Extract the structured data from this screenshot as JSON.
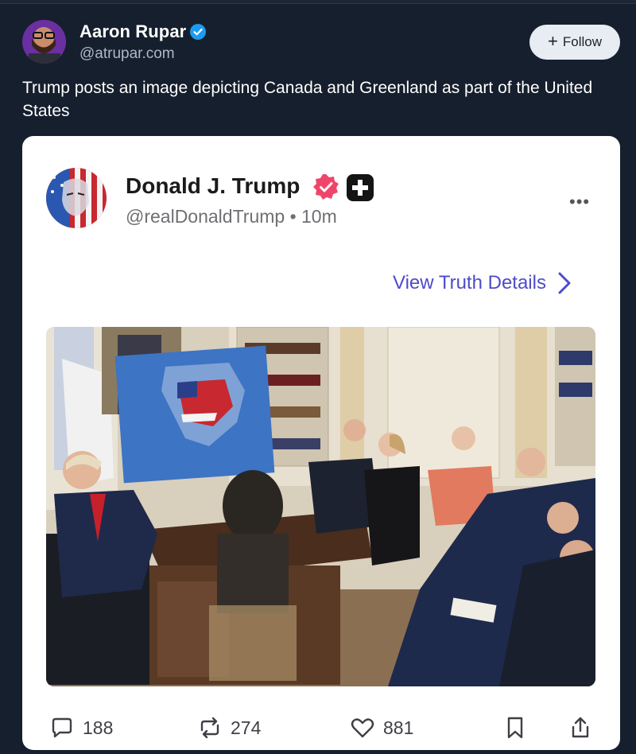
{
  "post": {
    "author_name": "Aaron Rupar",
    "author_handle": "@atrupar.com",
    "follow_label": "Follow",
    "text": "Trump posts an image depicting Canada and Greenland as part of the United States"
  },
  "embed": {
    "name": "Donald J. Trump",
    "handle": "@realDonaldTrump",
    "time": "• 10m",
    "more": "•••",
    "view_details": "View Truth Details",
    "stats": {
      "replies": "188",
      "reposts": "274",
      "likes": "881"
    }
  },
  "colors": {
    "background": "#161f2d",
    "accent_link": "#4e4bc9",
    "verified_blue": "#1d9bf0",
    "truth_verified": "#f0456b"
  },
  "icons": [
    "verified-icon",
    "plus-icon",
    "ellipsis-icon",
    "chevron-right-icon",
    "reply-icon",
    "repost-icon",
    "like-icon",
    "bookmark-icon",
    "share-icon"
  ]
}
